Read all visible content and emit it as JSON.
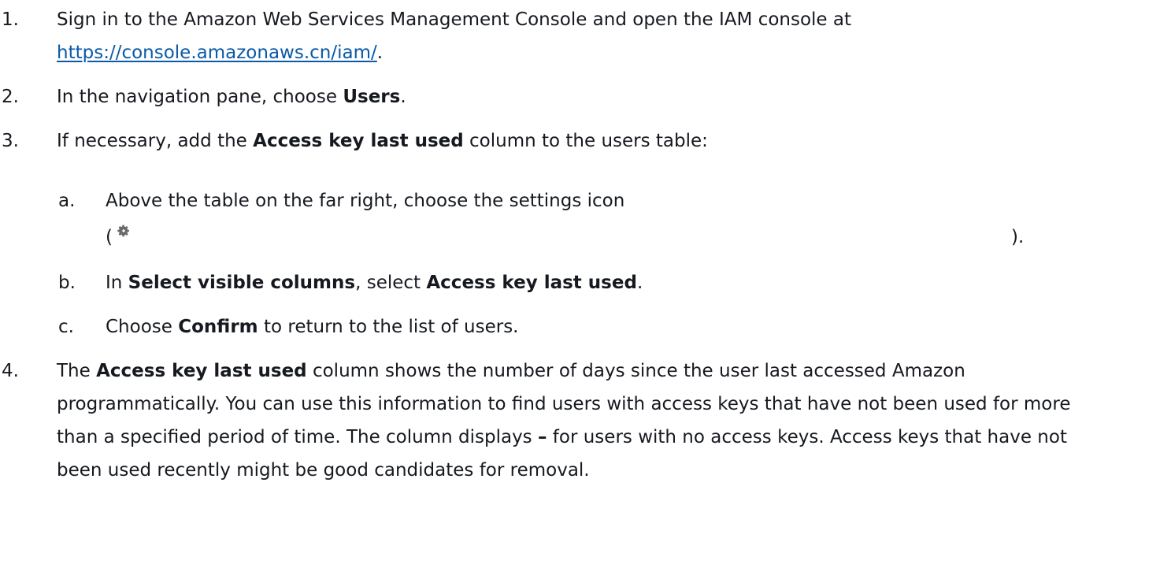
{
  "steps": [
    {
      "num": "1.",
      "text_a": "Sign in to the Amazon Web Services Management Console and open the IAM console at ",
      "link": "https://console.amazonaws.cn/iam/",
      "text_b": "."
    },
    {
      "num": "2.",
      "text_a": "In the navigation pane, choose ",
      "bold_a": "Users",
      "text_b": "."
    },
    {
      "num": "3.",
      "text_a": "If necessary, add the ",
      "bold_a": "Access key last used",
      "text_b": " column to the users table:"
    },
    {
      "num": "4.",
      "text_a": "The ",
      "bold_a": "Access key last used",
      "text_b": " column shows the number of days since the user last accessed Amazon programmatically. You can use this information to find users with access keys that have not been used for more than a specified period of time. The column displays ",
      "bold_b": "–",
      "text_c": " for users with no access keys. Access keys that have not been used recently might be good candidates for removal."
    }
  ],
  "substeps": [
    {
      "letter": "a.",
      "text_a": "Above the table on the far right, choose the settings icon",
      "paren_open": "(",
      "icon": "gear-icon",
      "paren_close": ")."
    },
    {
      "letter": "b.",
      "text_a": "In ",
      "bold_a": "Select visible columns",
      "text_b": ", select ",
      "bold_b": "Access key last used",
      "text_c": "."
    },
    {
      "letter": "c.",
      "text_a": "Choose ",
      "bold_a": "Confirm",
      "text_b": " to return to the list of users."
    }
  ]
}
